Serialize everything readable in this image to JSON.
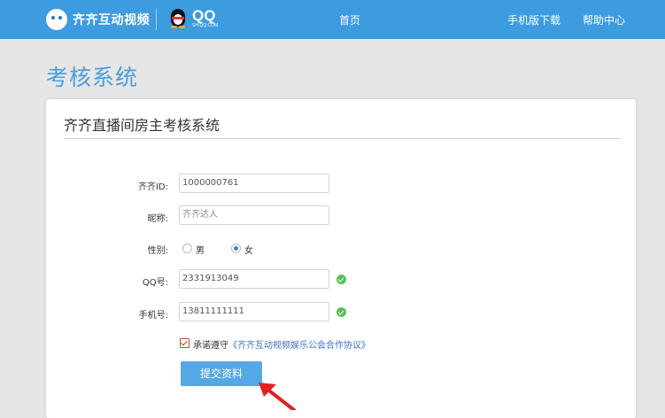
{
  "header": {
    "brand_title": "齐齐互动视频",
    "qq_logo": "QQ",
    "qq_domain": "SH.QQ.COM",
    "nav": {
      "home": "首页",
      "mobile_download": "手机版下载",
      "help_center": "帮助中心"
    }
  },
  "page_title": "考核系统",
  "card": {
    "title": "齐齐直播间房主考核系统",
    "form": {
      "qiqi_id": {
        "label": "齐齐ID:",
        "value": "1000000761"
      },
      "nickname": {
        "label": "昵称:",
        "value": "齐齐达人"
      },
      "gender": {
        "label": "性别:",
        "options": [
          "男",
          "女"
        ],
        "selected": "女"
      },
      "qq": {
        "label": "QQ号:",
        "value": "2331913049"
      },
      "phone": {
        "label": "手机号:",
        "value": "13811111111"
      },
      "agreement": {
        "prefix": "承诺遵守",
        "link": "《齐齐互动视频娱乐公会合作协议》",
        "checked": true
      },
      "submit_label": "提交资料"
    }
  },
  "colors": {
    "header_bg": "#3d9be0",
    "title_blue": "#4a9ddb",
    "button_bg": "#56a8e5",
    "check_green": "#5cbf5a",
    "arrow_red": "#e02020"
  }
}
